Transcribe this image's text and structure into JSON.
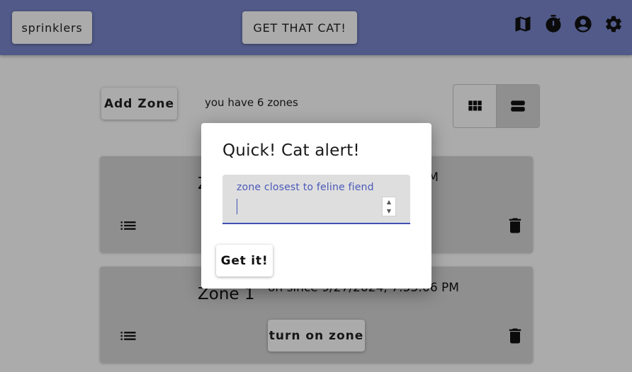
{
  "topbar": {
    "brand_label": "sprinklers",
    "cat_button_label": "GET THAT CAT!",
    "icons": [
      "map-icon",
      "timer-icon",
      "account-icon",
      "settings-gear-icon"
    ]
  },
  "toolbar": {
    "add_zone_label": "Add Zone",
    "zone_count_text": "you have 6 zones",
    "view_modes": [
      "grid-view-icon",
      "list-view-icon"
    ],
    "selected_view": "list-view-icon"
  },
  "zones": [
    {
      "name": "Z",
      "status_text": "PM"
    },
    {
      "name": "Zone 1",
      "status_text": "on since 9/27/2024, 7:55:06 PM",
      "turn_on_label": "turn on zone"
    }
  ],
  "dialog": {
    "title": "Quick! Cat alert!",
    "field_label": "zone closest to feline fiend",
    "field_value": "",
    "submit_label": "Get it!"
  },
  "colors": {
    "appbar": "#7986cb",
    "accent": "#3f51b5",
    "card": "#d6d6d6"
  }
}
